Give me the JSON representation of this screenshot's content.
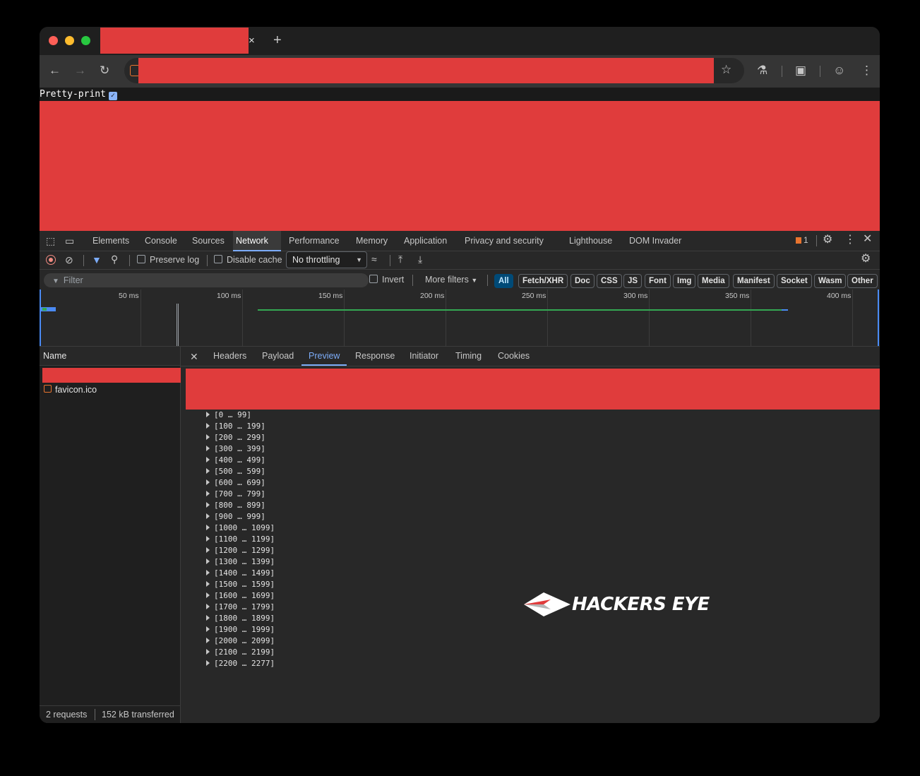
{
  "browser": {
    "new_tab_symbol": "+",
    "tab_close_symbol": "×"
  },
  "page": {
    "pretty_print_label": "Pretty-print",
    "pretty_print_checked": true
  },
  "devtools": {
    "main_tabs": [
      "Elements",
      "Console",
      "Sources",
      "Network",
      "Performance",
      "Memory",
      "Application",
      "Privacy and security",
      "Lighthouse",
      "DOM Invader"
    ],
    "active_main_tab": "Network",
    "issues_count": "1",
    "toolbar": {
      "preserve_log": "Preserve log",
      "disable_cache": "Disable cache",
      "throttling": "No throttling"
    },
    "filter": {
      "placeholder": "Filter",
      "invert": "Invert",
      "more_filters": "More filters",
      "types": [
        "All",
        "Fetch/XHR",
        "Doc",
        "CSS",
        "JS",
        "Font",
        "Img",
        "Media",
        "Manifest",
        "Socket",
        "Wasm",
        "Other"
      ],
      "active_type": "All"
    },
    "overview": {
      "tick_labels": [
        "50 ms",
        "100 ms",
        "150 ms",
        "200 ms",
        "250 ms",
        "300 ms",
        "350 ms",
        "400 ms"
      ]
    },
    "requests": {
      "column_name": "Name",
      "items": [
        "favicon.ico"
      ],
      "status_requests": "2 requests",
      "status_transferred": "152 kB transferred"
    },
    "detail_tabs": [
      "Headers",
      "Payload",
      "Preview",
      "Response",
      "Initiator",
      "Timing",
      "Cookies"
    ],
    "active_detail_tab": "Preview",
    "preview_ranges": [
      "[0 … 99]",
      "[100 … 199]",
      "[200 … 299]",
      "[300 … 399]",
      "[400 … 499]",
      "[500 … 599]",
      "[600 … 699]",
      "[700 … 799]",
      "[800 … 899]",
      "[900 … 999]",
      "[1000 … 1099]",
      "[1100 … 1199]",
      "[1200 … 1299]",
      "[1300 … 1399]",
      "[1400 … 1499]",
      "[1500 … 1599]",
      "[1600 … 1699]",
      "[1700 … 1799]",
      "[1800 … 1899]",
      "[1900 … 1999]",
      "[2000 … 2099]",
      "[2100 … 2199]",
      "[2200 … 2277]"
    ]
  },
  "watermark": {
    "text": "HACKERS EYE"
  },
  "colors": {
    "redaction": "#e03c3c",
    "accent": "#7cacf8"
  }
}
